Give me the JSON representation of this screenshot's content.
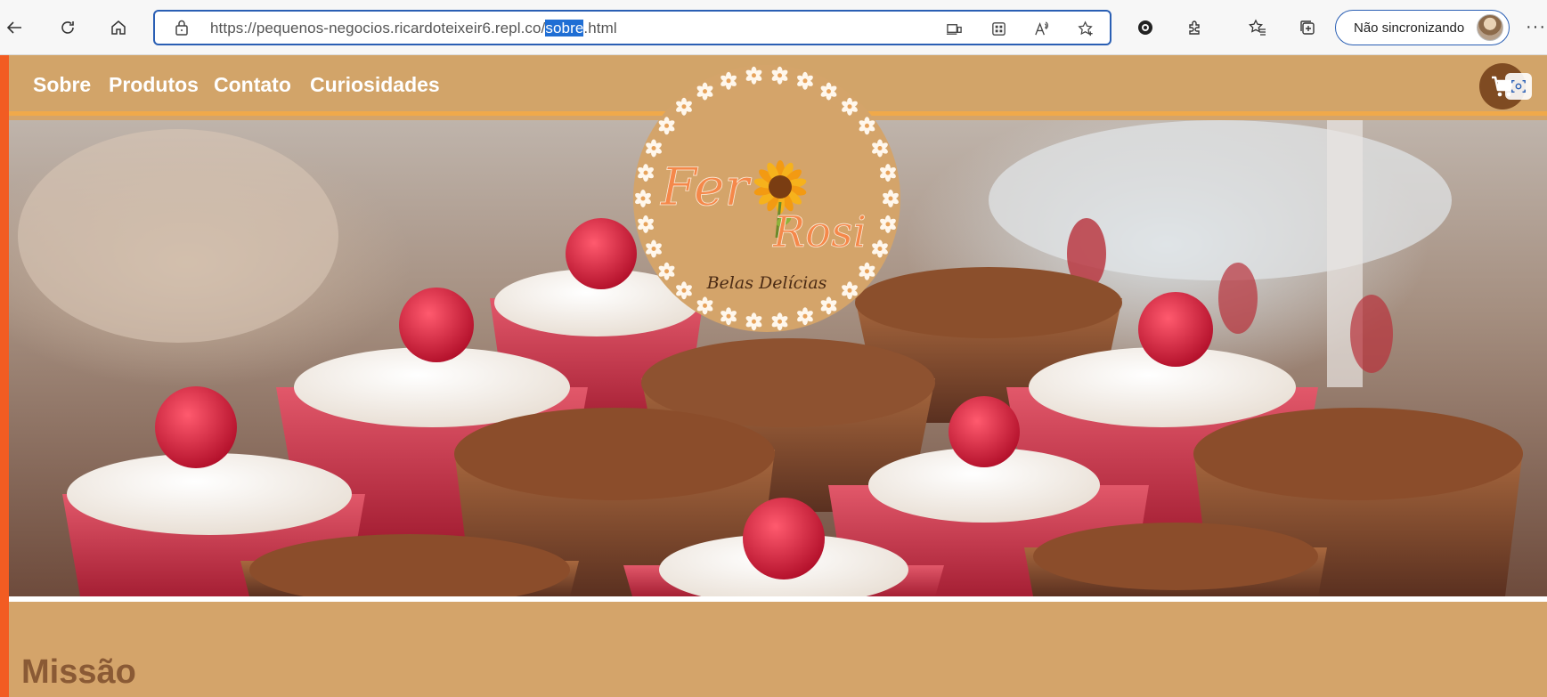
{
  "browser": {
    "url_prefix": "https://pequenos-negocios.ricardoteixeir6.repl.co/",
    "url_highlight": "sobre",
    "url_suffix": ".html",
    "sync_label": "Não sincronizando",
    "menu_glyph": "···",
    "icons": [
      "back-icon",
      "refresh-icon",
      "home-icon",
      "lock-icon",
      "immersive-reader-icon",
      "app-available-icon",
      "read-aloud-icon",
      "add-favorite-icon",
      "copilot-icon",
      "extensions-icon",
      "favorites-icon",
      "collections-icon",
      "profile-avatar",
      "more-icon"
    ],
    "accent_color": "#2a5fb4"
  },
  "site": {
    "nav": {
      "items": [
        {
          "label": "Sobre"
        },
        {
          "label": "Produtos"
        },
        {
          "label": "Contato"
        },
        {
          "label": "Curiosidades"
        }
      ]
    },
    "logo": {
      "line1": "Fer",
      "line2": "Rosi",
      "tagline": "Belas Delícias"
    },
    "section_title": "Missão",
    "colors": {
      "header_bg": "#d2a469",
      "header_border": "#f0a94a",
      "cart_bg": "#7f4b22",
      "page_bg": "#d4a46a",
      "title_color": "#8a5a35",
      "frame": "#f25c22"
    }
  }
}
